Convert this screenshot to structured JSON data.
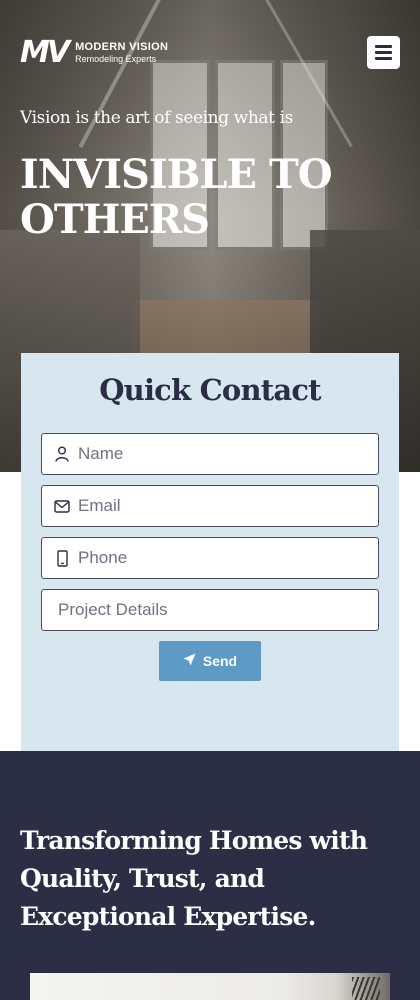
{
  "brand": {
    "mark": "MV",
    "name": "MODERN VISION",
    "subtitle": "Remodeling Experts"
  },
  "hero": {
    "tagline": "Vision is the art of seeing what is",
    "headline": "INVISIBLE TO OTHERS"
  },
  "contact": {
    "title": "Quick Contact",
    "fields": {
      "name": "Name",
      "email": "Email",
      "phone": "Phone",
      "details": "Project Details"
    },
    "send_label": "Send"
  },
  "about": {
    "heading": "Transforming Homes with Quality, Trust, and Exceptional Expertise."
  },
  "colors": {
    "navy": "#2c2e45",
    "card": "#d8e6f0",
    "accent": "#5d9ac5"
  },
  "icons": [
    "menu-icon",
    "user-icon",
    "mail-icon",
    "phone-icon",
    "send-icon"
  ]
}
